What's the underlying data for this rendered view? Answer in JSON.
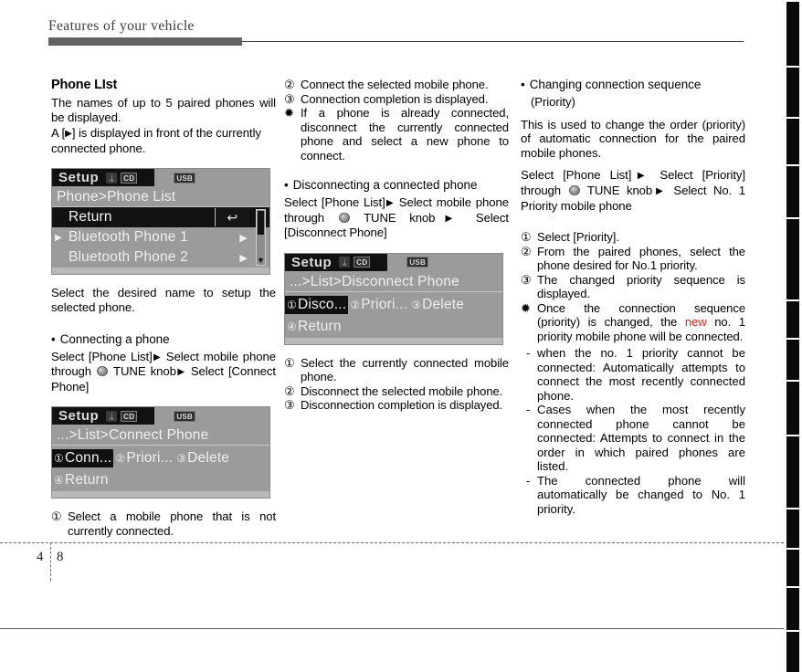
{
  "page": {
    "running_head": "Features of your vehicle",
    "folio_left": "4",
    "folio_right": "8"
  },
  "col1": {
    "heading": "Phone LIst",
    "intro1": "The names of up to 5 paired phones will be displayed.",
    "intro2_pre": "A [",
    "intro2_post": "] is displayed in front of the currently connected phone.",
    "after_lcd": "Select the desired name to setup the selected phone.",
    "connect_head_dot": "•",
    "connect_head": "Connecting a phone",
    "connect_step_pre": "Select [Phone List]",
    "connect_step_mid": "Select mobile phone through",
    "connect_step_knob_label": "TUNE knob",
    "connect_step_end": "Select [Connect Phone]",
    "note1_marker": "①",
    "note1": "Select a mobile phone that is not currently connected."
  },
  "col2": {
    "steps_top": [
      {
        "marker": "②",
        "text": "Connect the selected mobile phone."
      },
      {
        "marker": "③",
        "text": "Connection completion is displayed."
      },
      {
        "marker": "✹",
        "text": "If a phone is already connected, disconnect the currently connected phone and select a new phone to connect."
      }
    ],
    "disconnect_head_dot": "•",
    "disconnect_head": "Disconnecting a connected phone",
    "disconnect_step_pre": "Select [Phone List]",
    "disconnect_step_mid": "Select mobile phone through",
    "disconnect_step_knob_label": "TUNE knob",
    "disconnect_step_end": "Select [Disconnect Phone]",
    "steps_bottom": [
      {
        "marker": "①",
        "text": "Select the currently connected mobile phone."
      },
      {
        "marker": "②",
        "text": "Disconnect the selected mobile phone."
      },
      {
        "marker": "③",
        "text": "Disconnection completion is displayed."
      }
    ]
  },
  "col3": {
    "head_dot": "•",
    "head_line1": "Changing connection sequence",
    "head_line2": "(Priority)",
    "intro": "This is used to change the order (priority) of automatic connection for the paired mobile phones.",
    "select_pre": "Select [Phone List]",
    "select_mid": "Select [Priority] through",
    "select_knob_label": "TUNE knob",
    "select_end": "Select No. 1 Priority mobile phone",
    "steps": [
      {
        "marker": "①",
        "text": "Select [Priority]."
      },
      {
        "marker": "②",
        "text": "From the paired phones, select the phone desired for No.1 priority."
      },
      {
        "marker": "③",
        "text": "The changed priority sequence is displayed."
      }
    ],
    "note_marker": "✹",
    "note_a": "Once the connection sequence (priority) is changed, the",
    "note_red": "new",
    "note_b": "no. 1 priority mobile phone will be connected.",
    "dashes": [
      {
        "marker": "-",
        "text": "when the no. 1 priority cannot be connected: Automatically attempts to connect the most recently connected phone."
      },
      {
        "marker": "-",
        "text": "Cases when the most recently connected phone cannot be connected: Attempts to connect in the order in which paired phones are listed."
      },
      {
        "marker": "-",
        "text": "The connected phone will automatically be changed to No. 1 priority."
      }
    ]
  },
  "lcd_phone_list": {
    "title": "Setup",
    "icon_bt": "ᛦ",
    "icon_cd": "CD",
    "icon_usb": "USB",
    "path": "Phone>Phone List",
    "rows": [
      {
        "label": "Return",
        "selected": true,
        "left_arrow": "",
        "right_widget": "return-arrow",
        "return_glyph": "↩"
      },
      {
        "label": "Bluetooth Phone 1",
        "selected": false,
        "left_arrow": "▶",
        "right_widget": "chevron",
        "chevron": "▶"
      },
      {
        "label": "Bluetooth Phone 2",
        "selected": false,
        "left_arrow": "",
        "right_widget": "chevron",
        "chevron": "▶"
      }
    ],
    "scroll_down_glyph": "▼"
  },
  "lcd_connect_phone": {
    "title": "Setup",
    "icon_bt": "ᛦ",
    "icon_cd": "CD",
    "icon_usb": "USB",
    "path": "...>List>Connect Phone",
    "row1": [
      {
        "num": "①",
        "label": "Conn...",
        "highlighted": true
      },
      {
        "num": "②",
        "label": "Priori...",
        "highlighted": false
      },
      {
        "num": "③",
        "label": "Delete",
        "highlighted": false
      }
    ],
    "row2": [
      {
        "num": "④",
        "label": "Return",
        "highlighted": false
      }
    ]
  },
  "lcd_disconnect_phone": {
    "title": "Setup",
    "icon_bt": "ᛦ",
    "icon_cd": "CD",
    "icon_usb": "USB",
    "path": "...>List>Disconnect Phone",
    "row1": [
      {
        "num": "①",
        "label": "Disco...",
        "highlighted": true
      },
      {
        "num": "②",
        "label": "Priori...",
        "highlighted": false
      },
      {
        "num": "③",
        "label": "Delete",
        "highlighted": false
      }
    ],
    "row2": [
      {
        "num": "④",
        "label": "Return",
        "highlighted": false
      }
    ]
  },
  "glyphs": {
    "play_triangle": "▶",
    "step_arrow": "▶"
  }
}
